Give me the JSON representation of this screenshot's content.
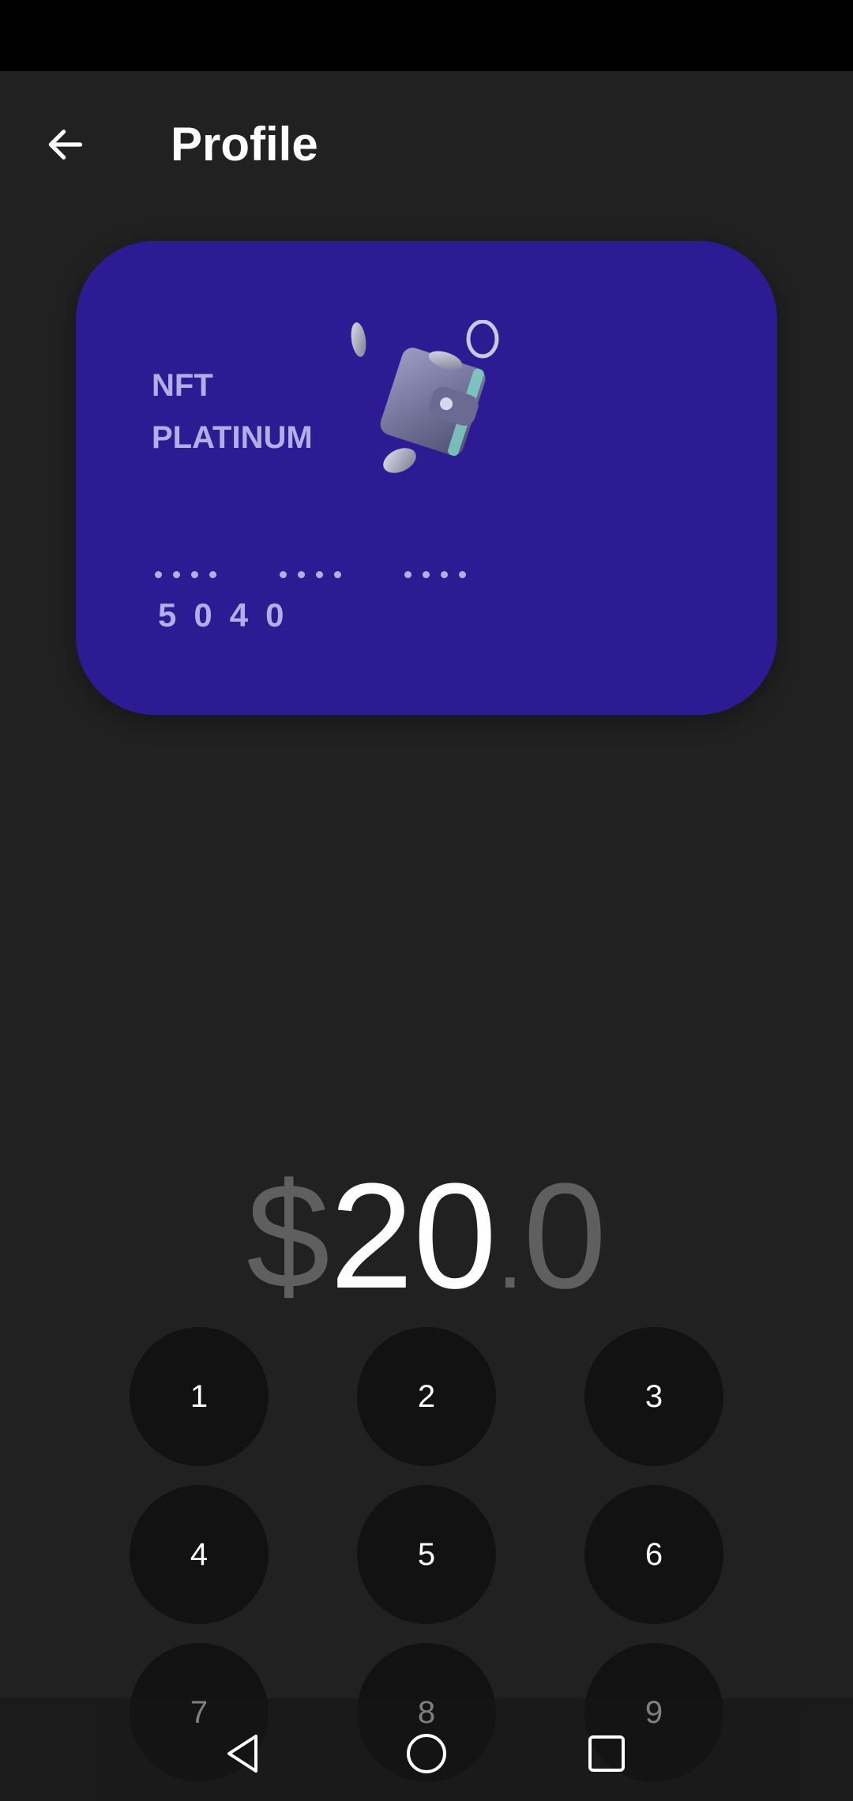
{
  "header": {
    "title": "Profile",
    "back_icon": "arrow-left-icon"
  },
  "card": {
    "tier_line1": "NFT",
    "tier_line2": "PLATINUM",
    "masked_groups": [
      "••••",
      "••••",
      "••••"
    ],
    "last4": "5040",
    "background_color": "#2d1b94",
    "text_color": "#b5aee6",
    "art_icon": "wallet-with-coins-icon"
  },
  "amount": {
    "currency": "$",
    "whole": "20",
    "separator": ".",
    "fraction": "0"
  },
  "keypad": {
    "keys": [
      "1",
      "2",
      "3",
      "4",
      "5",
      "6",
      "7",
      "8",
      "9"
    ]
  },
  "system_nav": {
    "back_icon": "triangle-back-icon",
    "home_icon": "circle-home-icon",
    "recents_icon": "square-recents-icon"
  }
}
